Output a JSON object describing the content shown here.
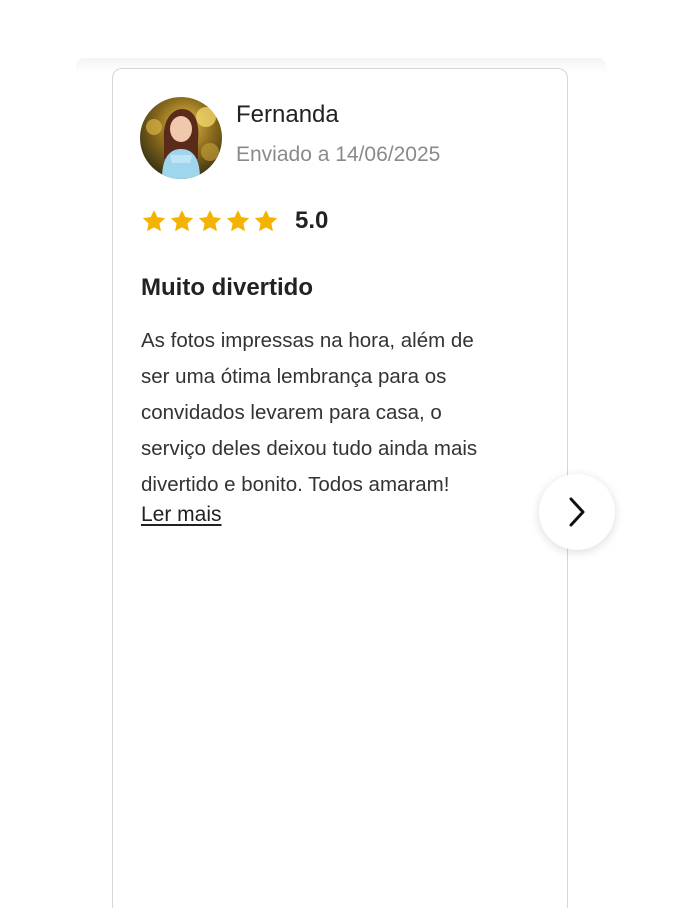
{
  "review": {
    "reviewer_name": "Fernanda",
    "date_text": "Enviado a 14/06/2025",
    "rating_value": "5.0",
    "rating_stars": 5,
    "title": "Muito divertido",
    "body_lines": [
      "As fotos impressas na hora, além de",
      "ser uma ótima lembrança para os",
      "convidados levarem para casa, o",
      "serviço deles deixou tudo ainda mais",
      "divertido e bonito. Todos amaram!"
    ],
    "read_more_label": "Ler mais"
  },
  "icons": {
    "star": "star-icon",
    "next": "chevron-right-icon"
  },
  "colors": {
    "star": "#F5B301",
    "border": "#D6D6D6",
    "muted_text": "#8A8A8A"
  }
}
